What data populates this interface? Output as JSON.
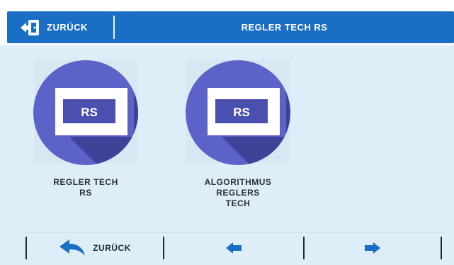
{
  "header": {
    "back_label": "ZURÜCK",
    "title": "REGLER TECH RS"
  },
  "tiles": [
    {
      "icon": "rs-controller-icon",
      "badge": "RS",
      "label": "REGLER TECH\nRS"
    },
    {
      "icon": "rs-controller-icon",
      "badge": "RS",
      "label": "ALGORITHMUS\nREGLERS\nTECH"
    }
  ],
  "bottom_nav": {
    "back_label": "ZURÜCK",
    "prev_icon": "arrow-left-icon",
    "next_icon": "arrow-right-icon"
  },
  "colors": {
    "accent": "#1a6fc4",
    "background": "#ddeef8",
    "circle": "#5c62c7",
    "circle_shadow": "#3f4398"
  }
}
